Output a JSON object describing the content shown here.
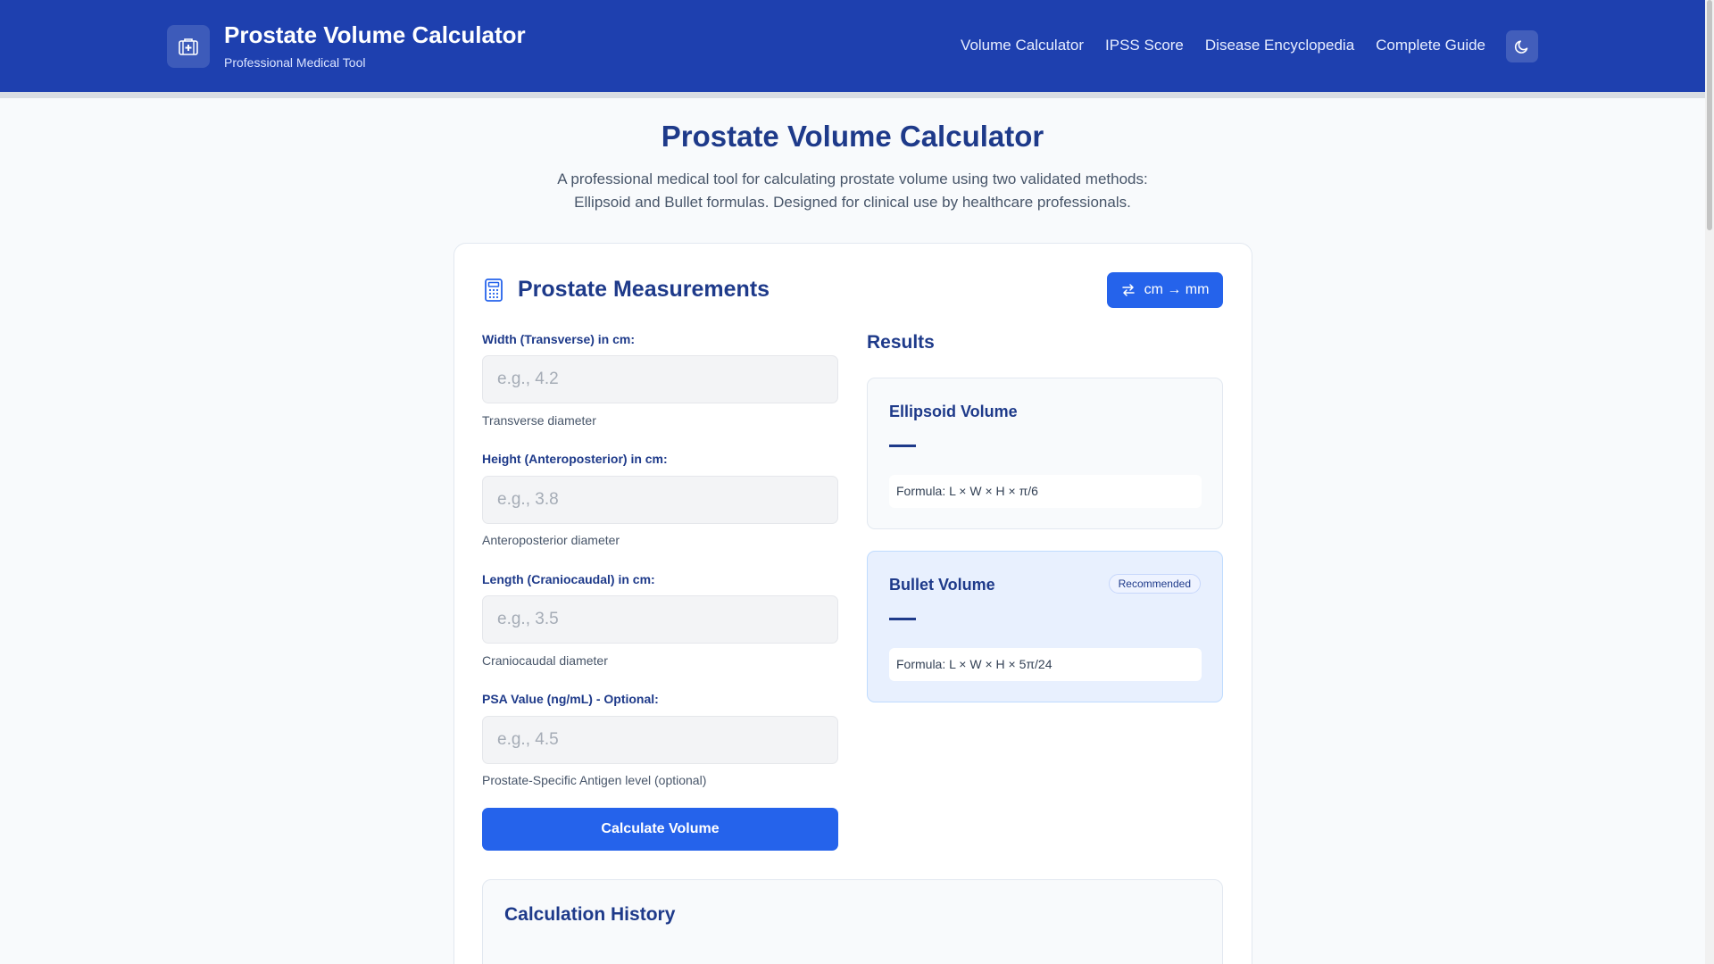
{
  "header": {
    "title": "Prostate Volume Calculator",
    "subtitle": "Professional Medical Tool",
    "nav": [
      "Volume Calculator",
      "IPSS Score",
      "Disease Encyclopedia",
      "Complete Guide"
    ],
    "brand_icon": "medical-kit-icon",
    "theme_icon": "moon-icon",
    "colors": {
      "header_bg": "#1e40af",
      "accent": "#2563eb",
      "title": "#1e3a8a"
    }
  },
  "hero": {
    "title": "Prostate Volume Calculator",
    "description": "A professional medical tool for calculating prostate volume using two validated methods: Ellipsoid and Bullet formulas. Designed for clinical use by healthcare professionals."
  },
  "card": {
    "title": "Prostate Measurements",
    "title_icon": "calculator-icon",
    "unit_toggle_label": "cm → mm",
    "unit_toggle_icon": "swap-arrows-icon"
  },
  "fields": [
    {
      "label": "Width (Transverse) in cm:",
      "placeholder": "e.g., 4.2",
      "help": "Transverse diameter",
      "value": ""
    },
    {
      "label": "Height (Anteroposterior) in cm:",
      "placeholder": "e.g., 3.8",
      "help": "Anteroposterior diameter",
      "value": ""
    },
    {
      "label": "Length (Craniocaudal) in cm:",
      "placeholder": "e.g., 3.5",
      "help": "Craniocaudal diameter",
      "value": ""
    },
    {
      "label": "PSA Value (ng/mL) - Optional:",
      "placeholder": "e.g., 4.5",
      "help": "Prostate-Specific Antigen level (optional)",
      "value": ""
    }
  ],
  "calculate_label": "Calculate Volume",
  "results": {
    "title": "Results",
    "ellipsoid": {
      "name": "Ellipsoid Volume",
      "value": "—",
      "formula": "Formula: L × W × H × π/6"
    },
    "bullet": {
      "name": "Bullet Volume",
      "value": "—",
      "badge": "Recommended",
      "formula": "Formula: L × W × H × 5π/24"
    }
  },
  "history": {
    "title": "Calculation History"
  }
}
